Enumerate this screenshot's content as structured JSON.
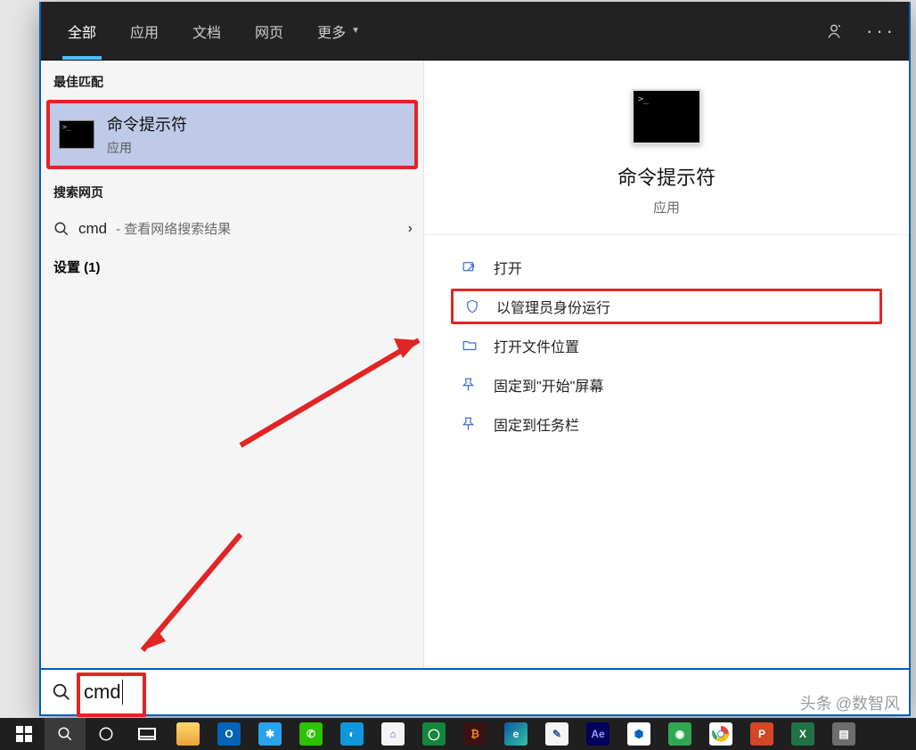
{
  "colors": {
    "accent_blue": "#005fb8",
    "highlight_red": "#e32424",
    "selection_bg": "#bfc9e8",
    "topbar_bg": "#222222"
  },
  "tabs": {
    "all": "全部",
    "apps": "应用",
    "docs": "文档",
    "web": "网页",
    "more": "更多"
  },
  "left": {
    "best_label": "最佳匹配",
    "best": {
      "title": "命令提示符",
      "sub": "应用"
    },
    "web_label": "搜索网页",
    "web": {
      "term": "cmd",
      "hint": " - 查看网络搜索结果"
    },
    "settings_label": "设置 (1)"
  },
  "preview": {
    "title": "命令提示符",
    "sub": "应用",
    "actions": {
      "open": "打开",
      "run_admin": "以管理员身份运行",
      "open_location": "打开文件位置",
      "pin_start": "固定到\"开始\"屏幕",
      "pin_taskbar": "固定到任务栏"
    }
  },
  "search": {
    "value": "cmd"
  },
  "watermark": {
    "prefix": "头条",
    "handle": "@数智风"
  }
}
